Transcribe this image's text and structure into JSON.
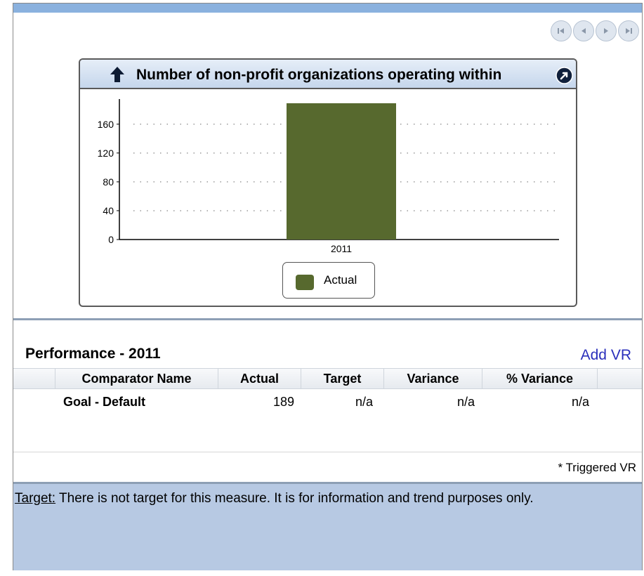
{
  "chart_title": "Number of non-profit organizations operating within",
  "nav": {
    "first": "first-icon",
    "prev": "previous-icon",
    "next": "next-icon",
    "last": "last-icon"
  },
  "chart_data": {
    "type": "bar",
    "categories": [
      "2011"
    ],
    "series": [
      {
        "name": "Actual",
        "values": [
          189
        ],
        "color": "#57692e"
      }
    ],
    "yticks": [
      0,
      40,
      80,
      120,
      160
    ],
    "ylim": [
      0,
      189
    ],
    "grid": true,
    "legend": "bottom-center"
  },
  "performance": {
    "title": "Performance  -  2011",
    "add_vr": "Add VR",
    "columns": [
      "Comparator Name",
      "Actual",
      "Target",
      "Variance",
      "% Variance"
    ],
    "rows": [
      {
        "name": "Goal - Default",
        "actual": "189",
        "target": "n/a",
        "variance": "n/a",
        "pct_variance": "n/a"
      }
    ],
    "triggered_note": "* Triggered VR"
  },
  "target_note": {
    "label": "Target:",
    "text": " There is not target for this measure.  It is for information and trend purposes only."
  }
}
